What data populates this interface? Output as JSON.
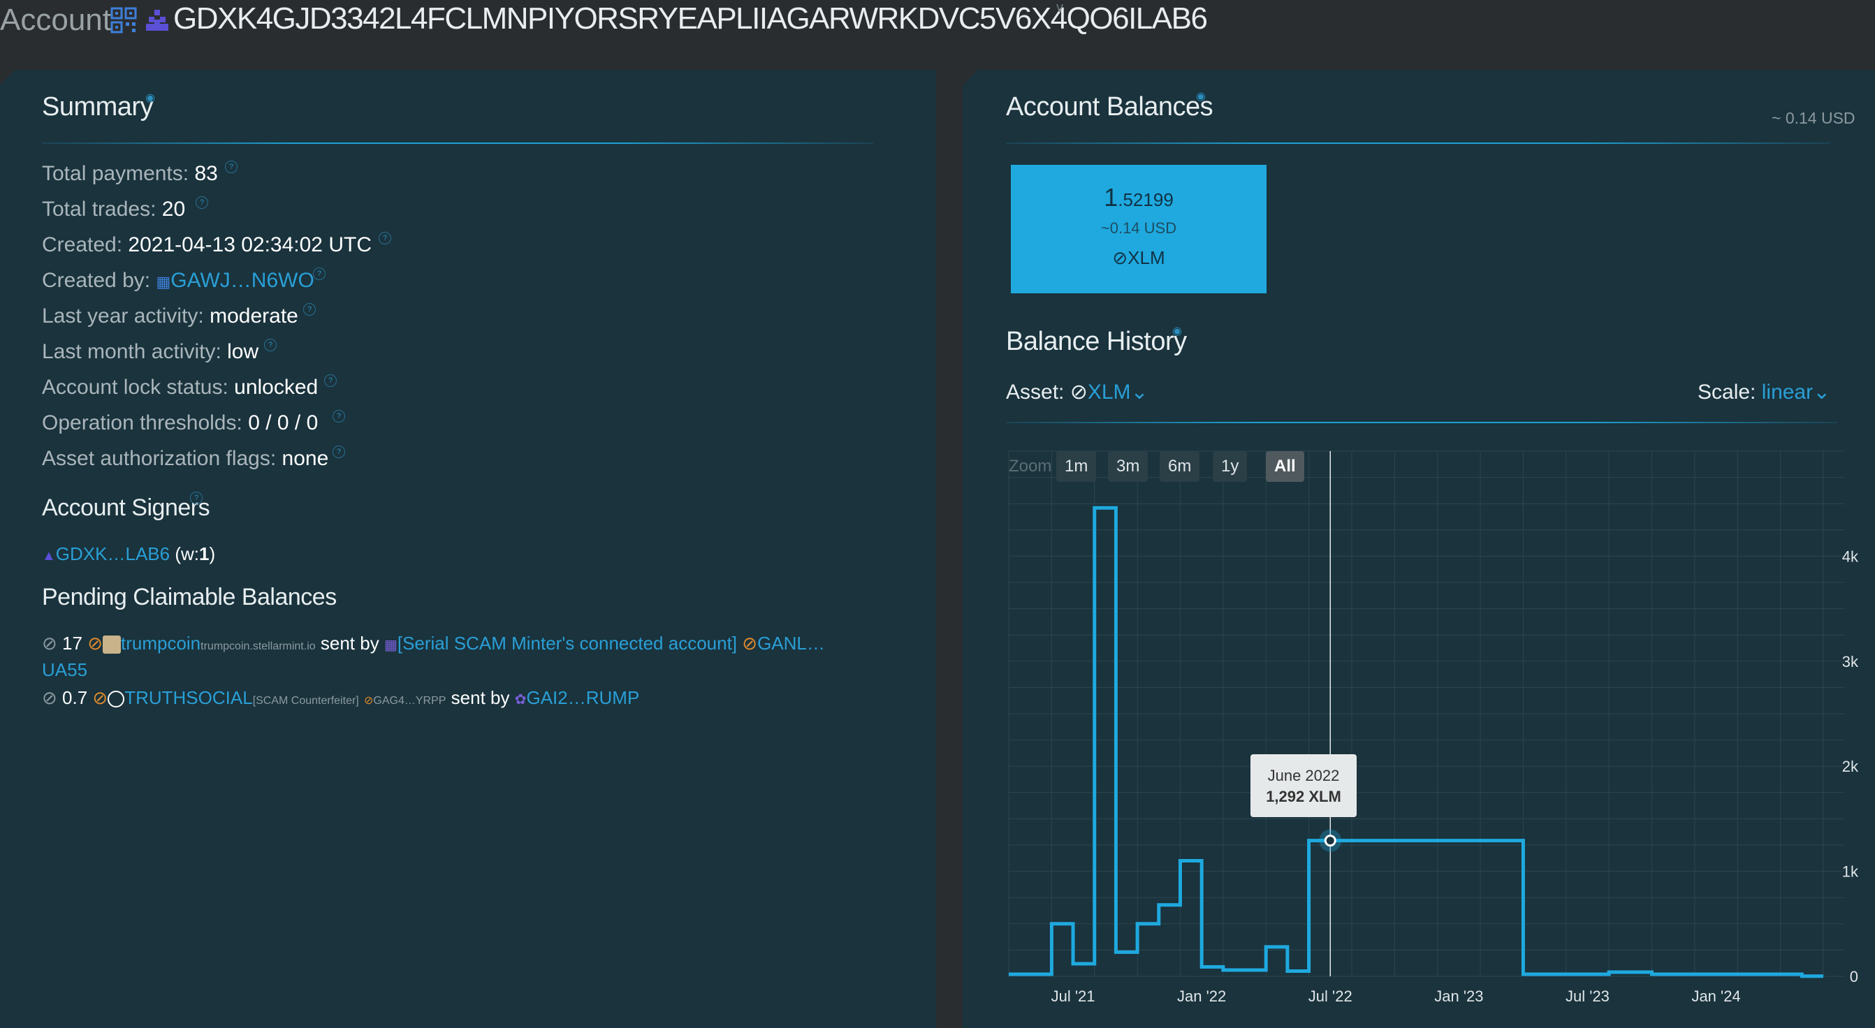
{
  "header": {
    "title": "Account",
    "account_id": "GDXK4GJD3342L4FCLMNPIYORSRYEAPLIIAGARWRKDVC5V6X4QO6ILAB6",
    "caret": "v"
  },
  "summary": {
    "heading": "Summary",
    "rows": [
      {
        "label": "Total payments:",
        "value": "83"
      },
      {
        "label": "Total trades:",
        "value": "20"
      },
      {
        "label": "Created:",
        "value": "2021-04-13 02:34:02 UTC"
      },
      {
        "label": "Created by:",
        "value": "GAWJ…N6WO"
      },
      {
        "label": "Last year activity:",
        "value": "moderate"
      },
      {
        "label": "Last month activity:",
        "value": "low"
      },
      {
        "label": "Account lock status:",
        "value": "unlocked"
      },
      {
        "label": "Operation thresholds:",
        "value": "0 / 0 / 0"
      },
      {
        "label": "Asset authorization flags:",
        "value": "none"
      }
    ],
    "signers_heading": "Account Signers",
    "signer": {
      "id": "GDXK…LAB6",
      "weight_prefix": "(w:",
      "weight": "1",
      "weight_suffix": ")"
    },
    "claimable_heading": "Pending Claimable Balances",
    "claimables": [
      {
        "amount": "17",
        "asset": "trumpcoin",
        "domain": "trumpcoin.stellarmint.io",
        "sent_by": "sent by",
        "sender": "[Serial SCAM Minter's connected account]",
        "issuer": "GANL…",
        "issuer_cont": "UA55"
      },
      {
        "amount": "0.7",
        "asset": "TRUTHSOCIAL",
        "tag": "[SCAM Counterfeiter]",
        "issuer": "GAG4…YRPP",
        "sent_by": "sent by",
        "sender": "GAI2…RUMP"
      }
    ]
  },
  "balances": {
    "heading": "Account Balances",
    "total_usd": "~ 0.14 USD",
    "card": {
      "amount_int": "1",
      "amount_frac": ".52199",
      "usd": "~0.14 USD",
      "asset": "XLM"
    }
  },
  "history": {
    "heading": "Balance History",
    "asset_label": "Asset:",
    "asset_value": "XLM",
    "scale_label": "Scale:",
    "scale_value": "linear",
    "zoom_label": "Zoom",
    "zoom_options": [
      "1m",
      "3m",
      "6m",
      "1y",
      "All"
    ],
    "zoom_active": "All",
    "tooltip": {
      "date": "June 2022",
      "value": "1,292 XLM"
    }
  },
  "colors": {
    "accent": "#1ea0d2",
    "panel": "#1a333d",
    "link": "#2a9fd6",
    "warn": "#e08a2a"
  },
  "chart_data": {
    "type": "line",
    "step": true,
    "ylabel": "Balance",
    "ylim": [
      0,
      5000
    ],
    "yticks": [
      "0",
      "1k",
      "2k",
      "3k",
      "4k"
    ],
    "yticks_values": [
      0,
      1000,
      2000,
      3000,
      4000
    ],
    "xticks": [
      "Jul '21",
      "Jan '22",
      "Jul '22",
      "Jan '23",
      "Jul '23",
      "Jan '24"
    ],
    "xticks_values": [
      "2021-07",
      "2022-01",
      "2022-07",
      "2023-01",
      "2023-07",
      "2024-01"
    ],
    "series": [
      {
        "x": [
          "2021-04",
          "2021-05",
          "2021-06",
          "2021-07",
          "2021-08",
          "2021-09",
          "2021-10",
          "2021-11",
          "2021-12",
          "2022-01",
          "2022-02",
          "2022-03",
          "2022-04",
          "2022-05",
          "2022-06",
          "2022-07",
          "2022-08",
          "2022-09",
          "2022-10",
          "2022-11",
          "2022-12",
          "2023-01",
          "2023-02",
          "2023-03",
          "2023-04",
          "2023-05",
          "2023-06",
          "2023-07",
          "2023-08",
          "2023-09",
          "2023-10",
          "2023-11",
          "2023-12",
          "2024-01",
          "2024-02",
          "2024-03",
          "2024-04",
          "2024-05"
        ],
        "values": [
          20,
          20,
          500,
          120,
          4460,
          230,
          500,
          680,
          1100,
          90,
          60,
          60,
          280,
          50,
          1292,
          1292,
          1292,
          1292,
          1292,
          1292,
          1292,
          1292,
          1292,
          1292,
          20,
          20,
          20,
          20,
          40,
          40,
          20,
          20,
          20,
          20,
          20,
          20,
          20,
          2
        ]
      }
    ]
  }
}
